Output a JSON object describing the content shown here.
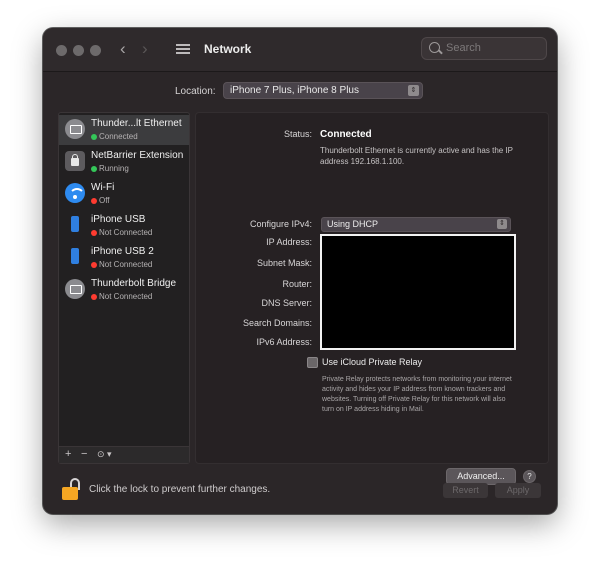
{
  "window": {
    "title": "Network",
    "search_placeholder": "Search"
  },
  "location": {
    "label": "Location:",
    "value": "iPhone 7 Plus, iPhone 8 Plus"
  },
  "sidebar": {
    "items": [
      {
        "name": "Thunder...lt Ethernet",
        "status": "Connected",
        "status_color": "#34c759",
        "icon": "ethernet-icon",
        "selected": true
      },
      {
        "name": "NetBarrier Extension",
        "status": "Running",
        "status_color": "#34c759",
        "icon": "extension-lock-icon",
        "selected": false
      },
      {
        "name": "Wi-Fi",
        "status": "Off",
        "status_color": "#ff3b30",
        "icon": "wifi-icon",
        "selected": false
      },
      {
        "name": "iPhone USB",
        "status": "Not Connected",
        "status_color": "#ff3b30",
        "icon": "iphone-icon",
        "selected": false
      },
      {
        "name": "iPhone USB 2",
        "status": "Not Connected",
        "status_color": "#ff3b30",
        "icon": "iphone-icon",
        "selected": false
      },
      {
        "name": "Thunderbolt Bridge",
        "status": "Not Connected",
        "status_color": "#ff3b30",
        "icon": "ethernet-icon",
        "selected": false
      }
    ],
    "footer": {
      "add": "+",
      "remove": "−",
      "actions": "⊙ ▾"
    }
  },
  "detail": {
    "status_label": "Status:",
    "status_value": "Connected",
    "status_description": "Thunderbolt Ethernet is currently active and has the IP address 192.168.1.100.",
    "configure_label": "Configure IPv4:",
    "configure_value": "Using DHCP",
    "field_labels": [
      "IP Address:",
      "Subnet Mask:",
      "Router:",
      "DNS Server:",
      "Search Domains:",
      "IPv6 Address:"
    ],
    "relay_label": "Use iCloud Private Relay",
    "relay_description": "Private Relay protects networks from monitoring your internet activity and hides your IP address from known trackers and websites. Turning off Private Relay for this network will also turn on IP address hiding in Mail.",
    "advanced_label": "Advanced...",
    "help_label": "?"
  },
  "footer": {
    "lock_text": "Click the lock to prevent further changes.",
    "revert_label": "Revert",
    "apply_label": "Apply"
  }
}
